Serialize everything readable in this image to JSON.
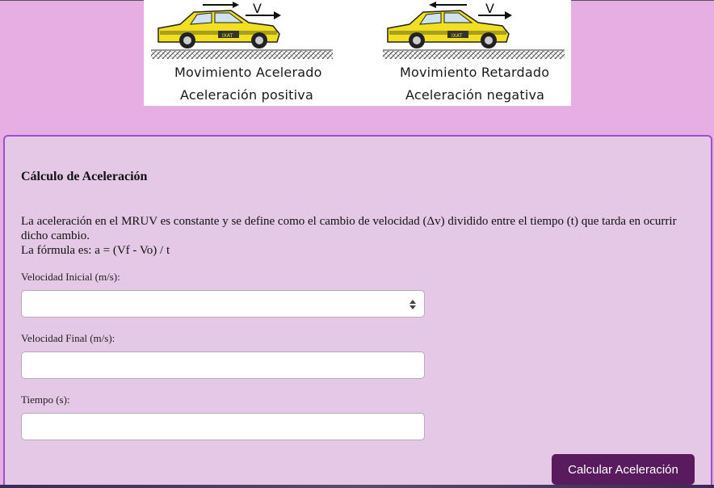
{
  "illustration": {
    "velocity_symbol": "V",
    "taxi_sign": "IXAT",
    "left_caption_1": "Movimiento Acelerado",
    "left_caption_2": "Aceleración positiva",
    "right_caption_1": "Movimiento Retardado",
    "right_caption_2": "Aceleración negativa"
  },
  "card": {
    "title": "Cálculo de Aceleración",
    "description_1": "La aceleración en el MRUV es constante y se define como el cambio de velocidad (Δv) dividido entre el tiempo (t) que tarda en ocurrir dicho cambio.",
    "description_2": "La fórmula es: a = (Vf - Vo) / t",
    "fields": [
      {
        "label": "Velocidad Inicial (m/s):",
        "value": ""
      },
      {
        "label": "Velocidad Final (m/s):",
        "value": ""
      },
      {
        "label": "Tiempo (s):",
        "value": ""
      }
    ],
    "button_label": "Calcular Aceleración"
  },
  "colors": {
    "page_background": "#e6aee2",
    "card_background": "#e4c8e6",
    "card_border": "#9b4fd1",
    "button": "#5a1a5e",
    "taxi_body": "#f0e020"
  }
}
